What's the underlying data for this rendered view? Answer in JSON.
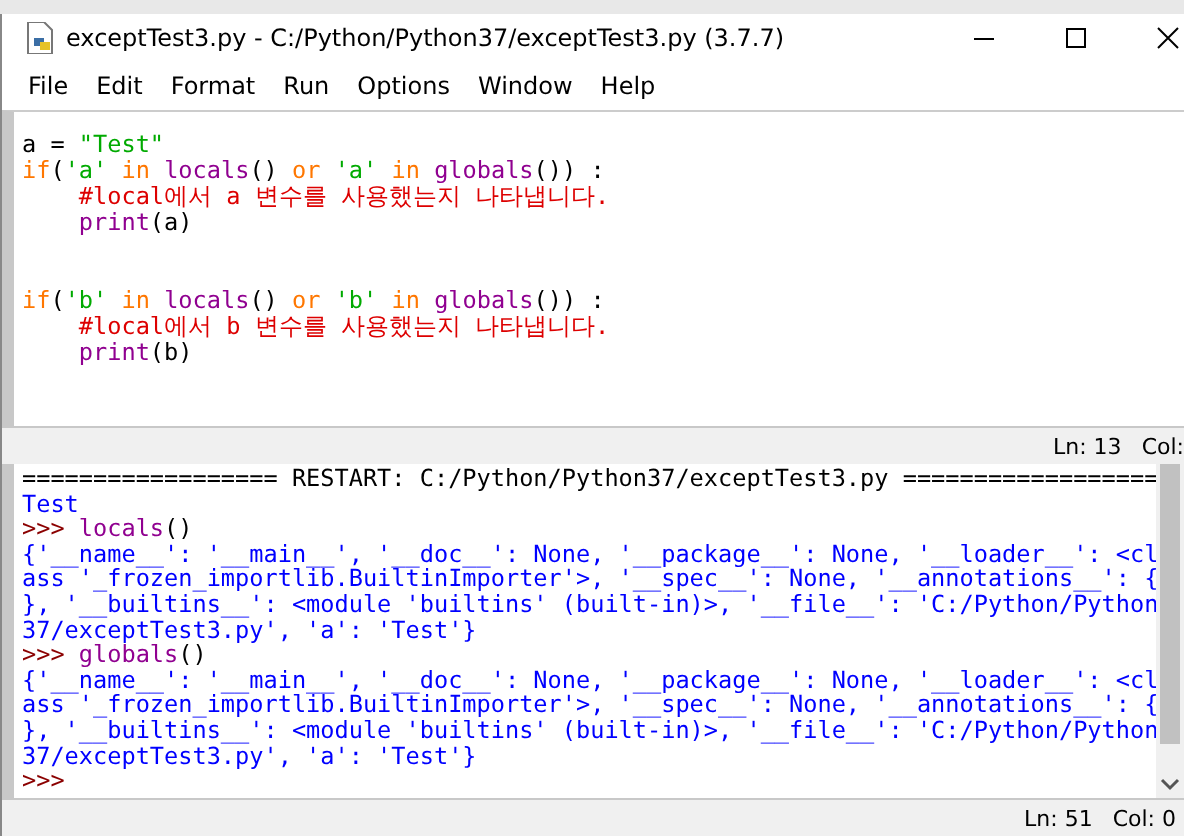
{
  "window": {
    "title": "exceptTest3.py - C:/Python/Python37/exceptTest3.py (3.7.7)"
  },
  "menu": [
    "File",
    "Edit",
    "Format",
    "Run",
    "Options",
    "Window",
    "Help"
  ],
  "editor": {
    "blocks": [
      [
        [
          {
            "text": "a = ",
            "kind": "default"
          },
          {
            "text": "\"Test\"",
            "kind": "string"
          }
        ],
        [
          {
            "text": "if",
            "kind": "keyword"
          },
          {
            "text": "(",
            "kind": "default"
          },
          {
            "text": "'a'",
            "kind": "string"
          },
          {
            "text": " in ",
            "kind": "keyword"
          },
          {
            "text": "locals",
            "kind": "builtin"
          },
          {
            "text": "() ",
            "kind": "default"
          },
          {
            "text": "or",
            "kind": "keyword"
          },
          {
            "text": " 'a'",
            "kind": "string"
          },
          {
            "text": " in ",
            "kind": "keyword"
          },
          {
            "text": "globals",
            "kind": "builtin"
          },
          {
            "text": "()) :",
            "kind": "default"
          }
        ],
        [
          {
            "text": "    #local에서 a 변수를 사용했는지 나타냅니다.",
            "kind": "comment"
          }
        ],
        [
          {
            "text": "    print",
            "kind": "builtin"
          },
          {
            "text": "(a)",
            "kind": "default"
          }
        ]
      ],
      [
        [
          {
            "text": "if",
            "kind": "keyword"
          },
          {
            "text": "(",
            "kind": "default"
          },
          {
            "text": "'b'",
            "kind": "string"
          },
          {
            "text": " in ",
            "kind": "keyword"
          },
          {
            "text": "locals",
            "kind": "builtin"
          },
          {
            "text": "() ",
            "kind": "default"
          },
          {
            "text": "or",
            "kind": "keyword"
          },
          {
            "text": " 'b'",
            "kind": "string"
          },
          {
            "text": " in ",
            "kind": "keyword"
          },
          {
            "text": "globals",
            "kind": "builtin"
          },
          {
            "text": "()) :",
            "kind": "default"
          }
        ],
        [
          {
            "text": "    #local에서 b 변수를 사용했는지 나타냅니다.",
            "kind": "comment"
          }
        ],
        [
          {
            "text": "    print",
            "kind": "builtin"
          },
          {
            "text": "(b)",
            "kind": "default"
          }
        ]
      ]
    ]
  },
  "editor_status": {
    "line": "Ln: 13",
    "col": "Col:"
  },
  "shell": {
    "lines": [
      [
        {
          "text": "================== RESTART: C:/Python/Python37/exceptTest3.py ==================",
          "kind": "default"
        }
      ],
      [
        {
          "text": "Test",
          "kind": "stdout"
        }
      ],
      [
        {
          "text": ">>> ",
          "kind": "prompt"
        },
        {
          "text": "locals",
          "kind": "builtin"
        },
        {
          "text": "()",
          "kind": "default"
        }
      ],
      [
        {
          "text": "{'__name__': '__main__', '__doc__': None, '__package__': None, '__loader__': <cl",
          "kind": "stdout"
        }
      ],
      [
        {
          "text": "ass '_frozen_importlib.BuiltinImporter'>, '__spec__': None, '__annotations__': {",
          "kind": "stdout"
        }
      ],
      [
        {
          "text": "}, '__builtins__': <module 'builtins' (built-in)>, '__file__': 'C:/Python/Python",
          "kind": "stdout"
        }
      ],
      [
        {
          "text": "37/exceptTest3.py', 'a': 'Test'}",
          "kind": "stdout"
        }
      ],
      [
        {
          "text": ">>> ",
          "kind": "prompt"
        },
        {
          "text": "globals",
          "kind": "builtin"
        },
        {
          "text": "()",
          "kind": "default"
        }
      ],
      [
        {
          "text": "{'__name__': '__main__', '__doc__': None, '__package__': None, '__loader__': <cl",
          "kind": "stdout"
        }
      ],
      [
        {
          "text": "ass '_frozen_importlib.BuiltinImporter'>, '__spec__': None, '__annotations__': {",
          "kind": "stdout"
        }
      ],
      [
        {
          "text": "}, '__builtins__': <module 'builtins' (built-in)>, '__file__': 'C:/Python/Python",
          "kind": "stdout"
        }
      ],
      [
        {
          "text": "37/exceptTest3.py', 'a': 'Test'}",
          "kind": "stdout"
        }
      ],
      [
        {
          "text": ">>>",
          "kind": "prompt"
        }
      ]
    ]
  },
  "shell_status": {
    "line": "Ln: 51",
    "col": "Col: 0"
  }
}
